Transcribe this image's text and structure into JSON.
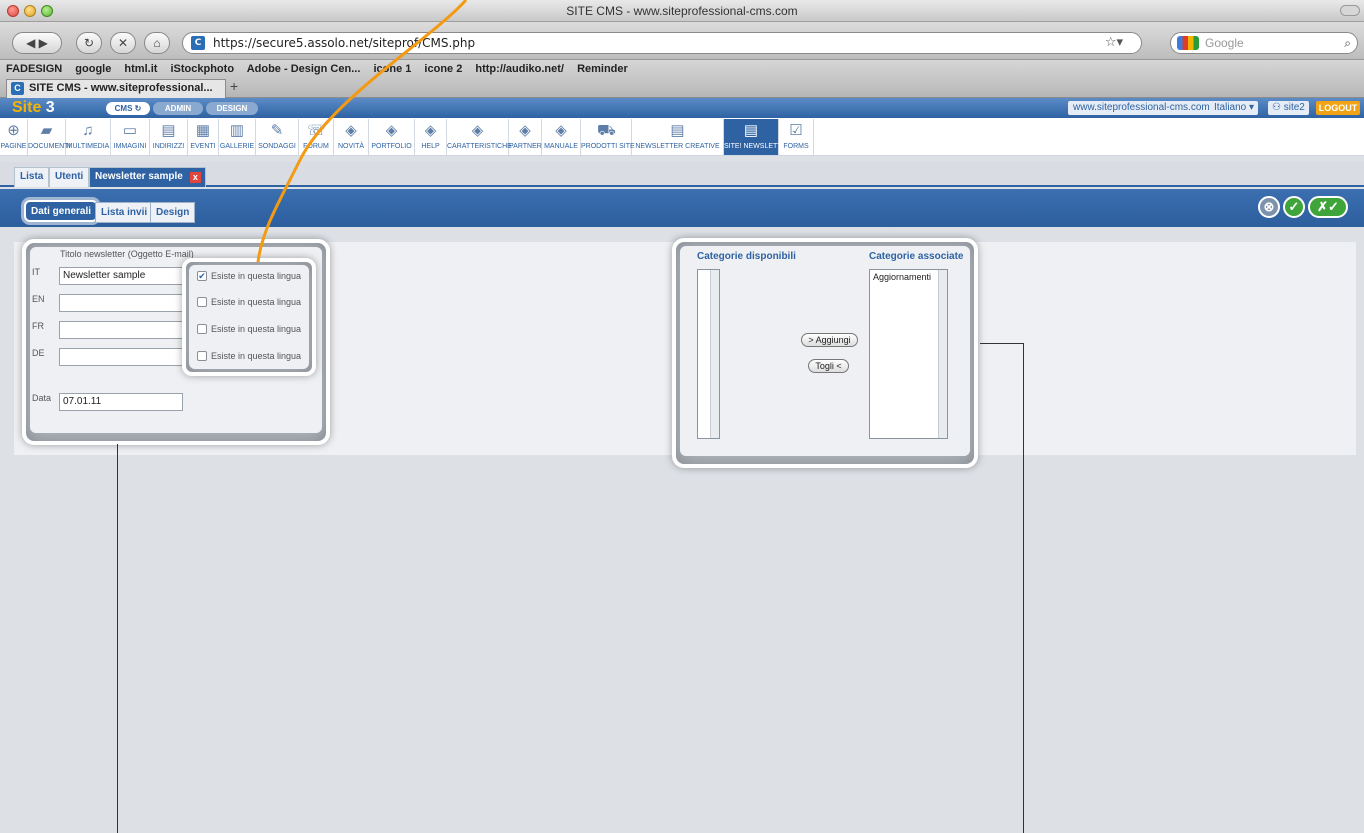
{
  "browser": {
    "window_title": "SITE CMS - www.siteprofessional-cms.com",
    "url": "https://secure5.assolo.net/siteprof/CMS.php",
    "search_placeholder": "Google",
    "bookmarks": [
      "FADESIGN",
      "google",
      "html.it",
      "iStockphoto",
      "Adobe - Design Cen...",
      "icone 1",
      "icone 2",
      "http://audiko.net/",
      "Reminder"
    ],
    "tab_title": "SITE CMS - www.siteprofessional...",
    "new_tab": "+"
  },
  "cms": {
    "logo_main": "Site",
    "logo_num": "3",
    "pills": {
      "cms": "CMS",
      "admin": "ADMIN",
      "design": "DESIGN"
    },
    "domain": "www.siteprofessional-cms.com",
    "language": "Italiano",
    "site": "site2",
    "logout": "LOGOUT"
  },
  "modules": [
    {
      "label": "PAGINE",
      "icon": "globe-icon"
    },
    {
      "label": "DOCUMENTI",
      "icon": "folder-icon"
    },
    {
      "label": "MULTIMEDIA",
      "icon": "multimedia-icon"
    },
    {
      "label": "IMMAGINI",
      "icon": "image-icon"
    },
    {
      "label": "INDIRIZZI",
      "icon": "address-icon"
    },
    {
      "label": "EVENTI",
      "icon": "calendar-icon"
    },
    {
      "label": "GALLERIE",
      "icon": "gallery-icon"
    },
    {
      "label": "SONDAGGI",
      "icon": "poll-icon"
    },
    {
      "label": "FORUM",
      "icon": "forum-icon"
    },
    {
      "label": "NOVITÀ",
      "icon": "box-icon"
    },
    {
      "label": "PORTFOLIO",
      "icon": "box-icon"
    },
    {
      "label": "HELP",
      "icon": "box-icon"
    },
    {
      "label": "CARATTERISTICHE",
      "icon": "box-icon"
    },
    {
      "label": "PARTNER",
      "icon": "box-icon"
    },
    {
      "label": "MANUALE",
      "icon": "box-icon"
    },
    {
      "label": "PRODOTTI SITE",
      "icon": "cart-icon"
    },
    {
      "label": "NEWSLETTER CREATIVE",
      "icon": "news-icon"
    },
    {
      "label": "SITE! NEWSLETTER",
      "icon": "news-icon"
    },
    {
      "label": "FORMS",
      "icon": "checkbox-icon"
    }
  ],
  "section_tabs": {
    "lista": "Lista",
    "utenti": "Utenti",
    "newsletter": "Newsletter sample",
    "close": "x"
  },
  "sub_tabs": {
    "dati": "Dati generali",
    "lista_invii": "Lista invii",
    "design": "Design"
  },
  "actions": {
    "cancel": "⊗",
    "save": "✓",
    "save_close": "✗✓"
  },
  "form": {
    "title_label": "Titolo newsletter (Oggetto E-mail)",
    "languages": [
      {
        "code": "IT",
        "value": "Newsletter sample",
        "exists": "Esiste in questa lingua",
        "checked": true
      },
      {
        "code": "EN",
        "value": "",
        "exists": "Esiste in questa lingua",
        "checked": false
      },
      {
        "code": "FR",
        "value": "",
        "exists": "Esiste in questa lingua",
        "checked": false
      },
      {
        "code": "DE",
        "value": "",
        "exists": "Esiste in questa lingua",
        "checked": false
      }
    ],
    "date_label": "Data",
    "date_value": "07.01.11"
  },
  "categories": {
    "available_label": "Categorie disponibili",
    "associated_label": "Categorie associate",
    "associated_items": [
      "Aggiornamenti"
    ],
    "add_label": "> Aggiungi",
    "remove_label": "Togli <"
  }
}
